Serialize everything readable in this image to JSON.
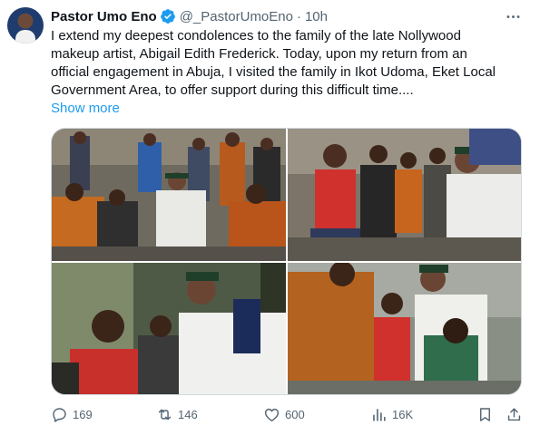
{
  "tweet": {
    "author_name": "Pastor Umo Eno",
    "handle": "@_PastorUmoEno",
    "separator": "·",
    "time": "10h",
    "verified_icon": "verified-badge-icon",
    "more_icon": "more-horizontal-icon",
    "text_lines": [
      "I extend my deepest condolences to the family of the late Nollywood",
      "makeup artist, Abigail Edith Frederick. Today, upon my return from an",
      "official engagement in Abuja, I visited the family in Ikot Udoma, Eket Local",
      "Government Area, to offer support during this difficult time...."
    ],
    "show_more": "Show more"
  },
  "actions": {
    "replies": "169",
    "retweets": "146",
    "likes": "600",
    "views": "16K"
  },
  "colors": {
    "accent": "#1d9bf0",
    "text": "#0f1419",
    "muted": "#536471",
    "border": "#cfd9de"
  }
}
